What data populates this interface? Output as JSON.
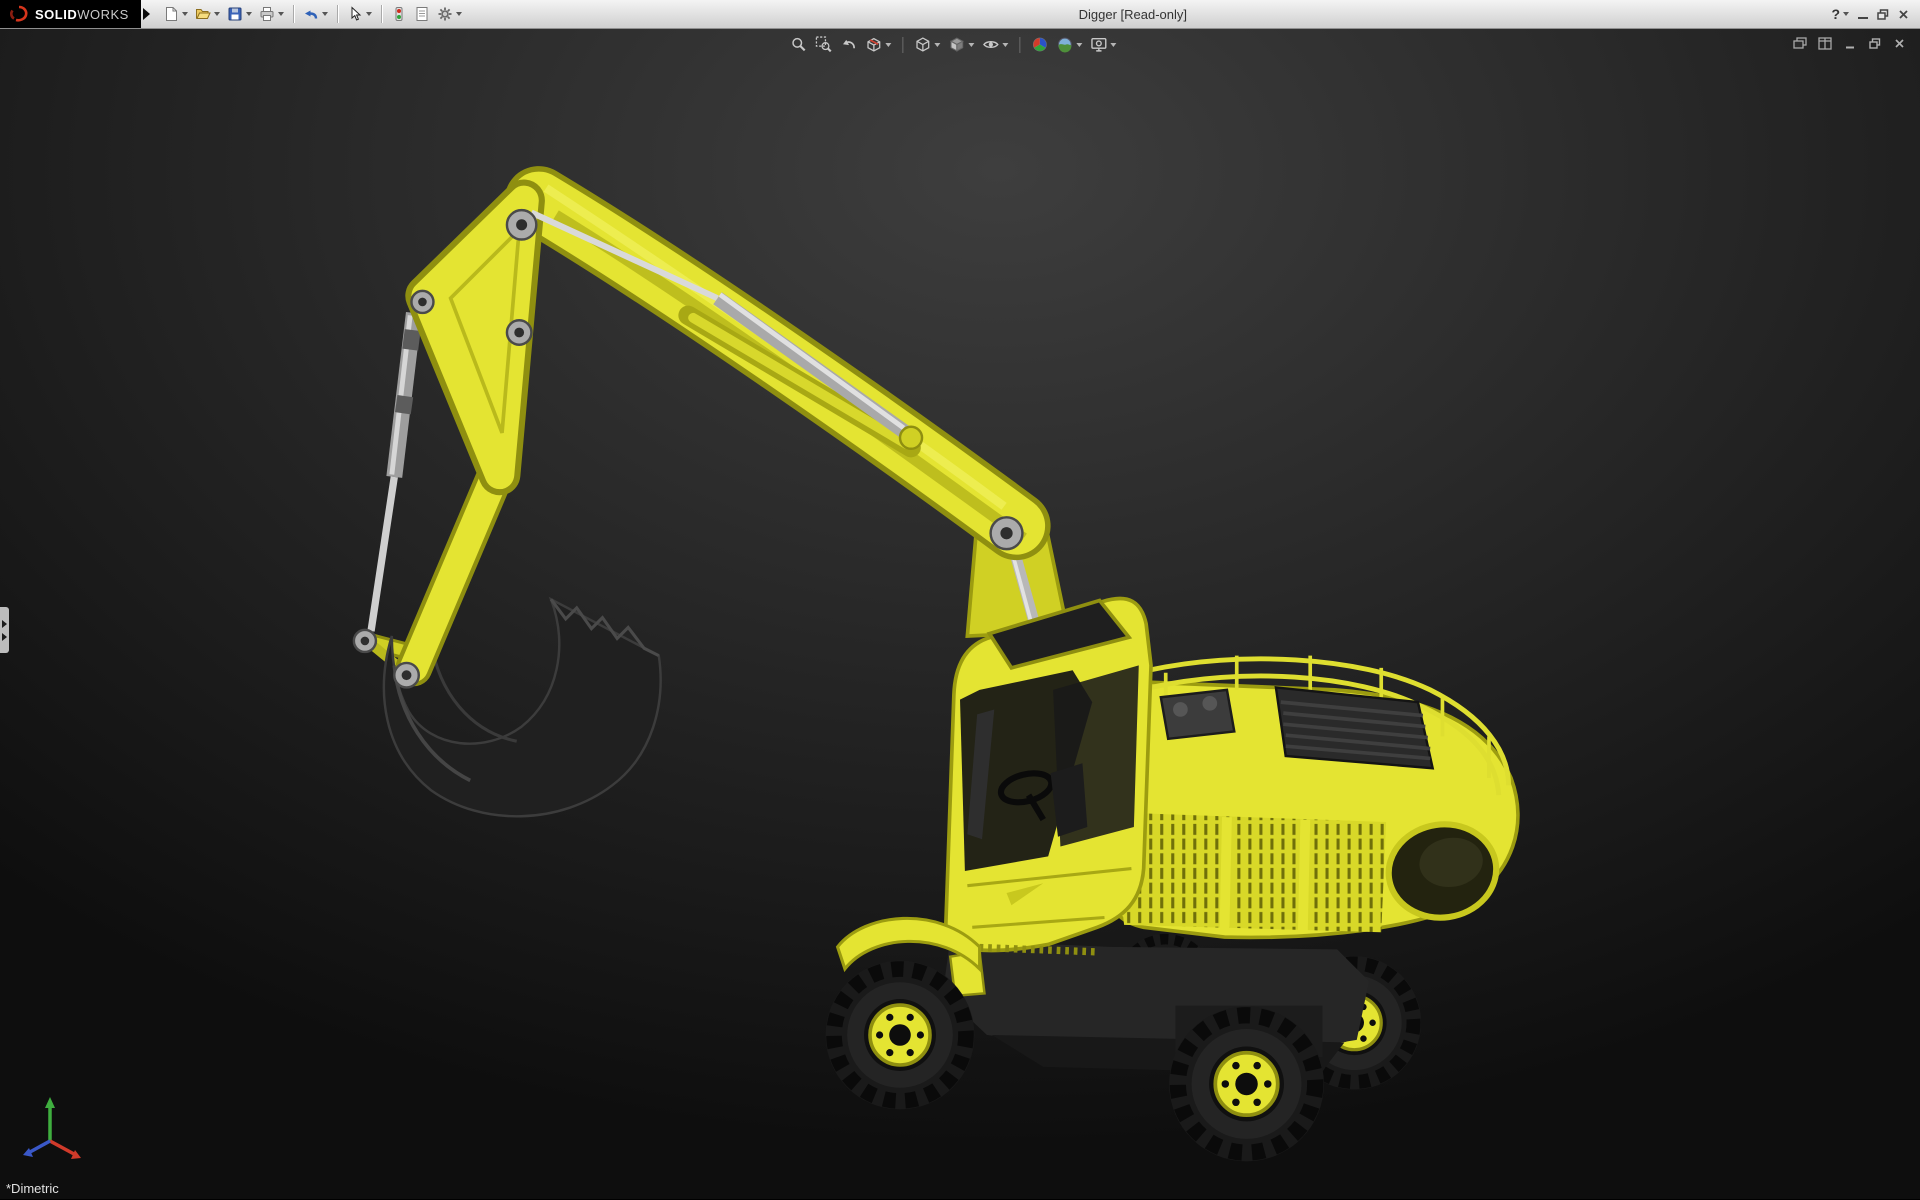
{
  "window": {
    "brand_solid": "SOLID",
    "brand_works": "WORKS",
    "title": "Digger [Read-only]",
    "help_glyph": "?",
    "controls": [
      "help",
      "minimize",
      "restore",
      "close"
    ]
  },
  "main_toolbar": {
    "items": [
      {
        "name": "new",
        "icon": "new-document-icon",
        "dropdown": true
      },
      {
        "name": "open",
        "icon": "open-folder-icon",
        "dropdown": true
      },
      {
        "name": "save",
        "icon": "save-floppy-icon",
        "dropdown": true
      },
      {
        "name": "print",
        "icon": "print-icon",
        "dropdown": true
      },
      {
        "name": "undo",
        "icon": "undo-arrow-icon",
        "dropdown": true
      },
      {
        "name": "select",
        "icon": "select-cursor-icon",
        "dropdown": true
      },
      {
        "name": "rebuild",
        "icon": "rebuild-stoplight-icon",
        "dropdown": false
      },
      {
        "name": "file-properties",
        "icon": "file-properties-icon",
        "dropdown": false
      },
      {
        "name": "options",
        "icon": "options-gear-icon",
        "dropdown": true
      }
    ]
  },
  "heads_up_toolbar": {
    "items": [
      {
        "name": "zoom-to-fit",
        "icon": "zoom-to-fit-icon",
        "dropdown": false
      },
      {
        "name": "zoom-to-area",
        "icon": "zoom-to-area-icon",
        "dropdown": false
      },
      {
        "name": "previous-view",
        "icon": "previous-view-icon",
        "dropdown": false
      },
      {
        "name": "section-view",
        "icon": "section-view-icon",
        "dropdown": true
      },
      {
        "name": "view-orientation",
        "icon": "view-orientation-cube-icon",
        "dropdown": true
      },
      {
        "name": "display-style",
        "icon": "display-style-cube-icon",
        "dropdown": true
      },
      {
        "name": "hide-show-items",
        "icon": "hide-show-eye-icon",
        "dropdown": true
      },
      {
        "name": "edit-appearance",
        "icon": "edit-appearance-sphere-icon",
        "dropdown": false
      },
      {
        "name": "apply-scene",
        "icon": "apply-scene-sphere-icon",
        "dropdown": true
      },
      {
        "name": "view-settings",
        "icon": "view-settings-icon",
        "dropdown": true
      }
    ]
  },
  "document_controls": [
    {
      "name": "cascade-windows",
      "icon": "cascade-windows-icon"
    },
    {
      "name": "tile-windows",
      "icon": "tile-windows-icon"
    },
    {
      "name": "minimize-document",
      "icon": "minimize-icon"
    },
    {
      "name": "restore-document",
      "icon": "restore-icon"
    },
    {
      "name": "close-document",
      "icon": "close-icon"
    }
  ],
  "viewport": {
    "view_label": "*Dimetric",
    "model_name": "Digger wheeled excavator 3D model",
    "triad": [
      {
        "axis": "x",
        "color": "#d03a2a"
      },
      {
        "axis": "y",
        "color": "#3fae3f"
      },
      {
        "axis": "z",
        "color": "#3a58c8"
      }
    ]
  },
  "colors": {
    "titlebar-top": "#f4f4f4",
    "titlebar-bottom": "#cfcfcf",
    "logo-bg": "#000000",
    "brand-red": "#d6351c",
    "vp-center": "#3e3e3e",
    "vp-edge": "#0e0e0e",
    "excavator-yellow": "#e4e432",
    "excavator-yellow-dark": "#b9b91c",
    "excavator-yellow-deep": "#8f8f10",
    "part-dark": "#262626",
    "part-darker": "#181818",
    "silver": "#b4b4b4",
    "silver-light": "#dedede",
    "hud-icon": "#c8c8c8"
  }
}
